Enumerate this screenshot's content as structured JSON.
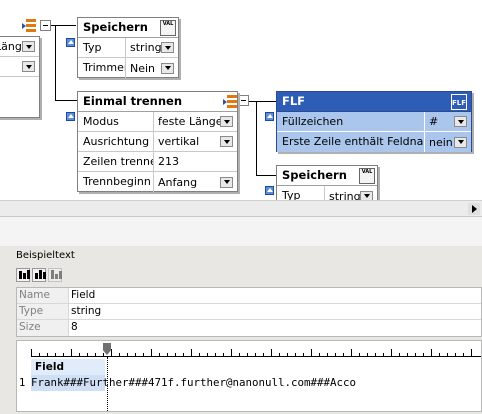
{
  "boxes": {
    "speichern1": {
      "title": "Speichern",
      "rows": [
        {
          "label": "Typ",
          "value": "string"
        },
        {
          "label": "Trimmen",
          "value": "Nein"
        }
      ]
    },
    "einmal": {
      "title": "Einmal trennen",
      "rows": [
        {
          "label": "Modus",
          "value": "feste Länge"
        },
        {
          "label": "Ausrichtung",
          "value": "vertikal"
        },
        {
          "label": "Zeilen trennen",
          "value": "213"
        },
        {
          "label": "Trennbeginn",
          "value": "Anfang"
        }
      ]
    },
    "flf": {
      "title": "FLF",
      "badge": "FLF",
      "rows": [
        {
          "label": "Füllzeichen",
          "value": "#"
        },
        {
          "label": "Erste Zeile enthält Feldnamen",
          "value": "nein"
        }
      ]
    },
    "speichern2": {
      "title": "Speichern",
      "rows": [
        {
          "label": "Typ",
          "value": "string"
        }
      ]
    }
  },
  "val_badge": "VAL",
  "left_partial": {
    "row1_fragment": "Länge"
  },
  "bottom": {
    "title": "Beispieltext",
    "props": [
      {
        "label": "Name",
        "value": "Field"
      },
      {
        "label": "Type",
        "value": "string"
      },
      {
        "label": "Size",
        "value": "8"
      }
    ],
    "field_header": "Field",
    "line_number": "1",
    "sample_text": "Frank###Further###471f.further@nanonull.com###Acco"
  },
  "icons": [
    "flow-icon",
    "val-icon",
    "collapse-icon",
    "dropdown-icon",
    "toolbar-columns-icon"
  ],
  "colors": {
    "flf_title": "#2e5db8",
    "flf_rows": "#aac6ec",
    "flow_orange": "#e07a10"
  }
}
